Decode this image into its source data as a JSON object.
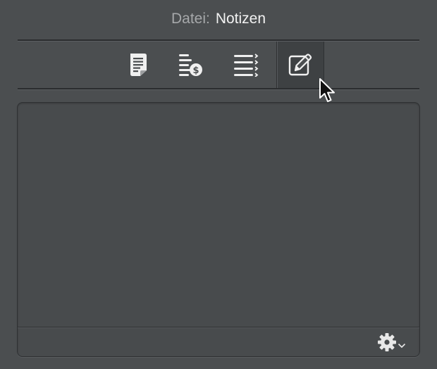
{
  "header": {
    "label": "Datei:",
    "value": "Notizen"
  },
  "toolbar": {
    "buttons": [
      {
        "icon": "document-lines-icon",
        "selected": false
      },
      {
        "icon": "list-dollar-icon",
        "selected": false
      },
      {
        "icon": "checklist-icon",
        "selected": false
      },
      {
        "icon": "pencil-square-icon",
        "selected": true
      }
    ]
  },
  "notes": {
    "value": ""
  },
  "footer": {
    "menu_icon": "gear-icon"
  },
  "colors": {
    "background": "#4b4e50",
    "text_primary": "#f2f2f2",
    "text_secondary": "#a6a8aa",
    "icon": "#f0f0f0"
  }
}
